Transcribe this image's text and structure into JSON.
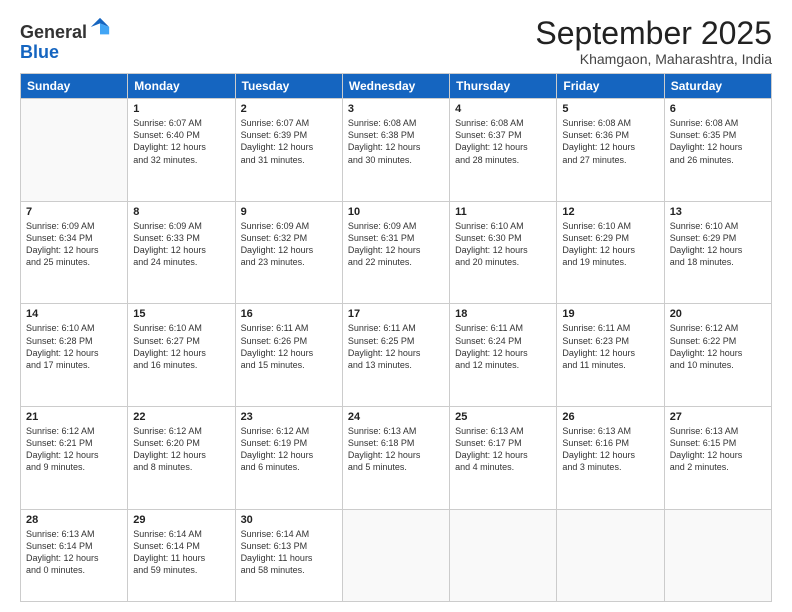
{
  "logo": {
    "general": "General",
    "blue": "Blue"
  },
  "title": "September 2025",
  "location": "Khamgaon, Maharashtra, India",
  "days_of_week": [
    "Sunday",
    "Monday",
    "Tuesday",
    "Wednesday",
    "Thursday",
    "Friday",
    "Saturday"
  ],
  "weeks": [
    [
      {
        "day": "",
        "info": ""
      },
      {
        "day": "1",
        "info": "Sunrise: 6:07 AM\nSunset: 6:40 PM\nDaylight: 12 hours\nand 32 minutes."
      },
      {
        "day": "2",
        "info": "Sunrise: 6:07 AM\nSunset: 6:39 PM\nDaylight: 12 hours\nand 31 minutes."
      },
      {
        "day": "3",
        "info": "Sunrise: 6:08 AM\nSunset: 6:38 PM\nDaylight: 12 hours\nand 30 minutes."
      },
      {
        "day": "4",
        "info": "Sunrise: 6:08 AM\nSunset: 6:37 PM\nDaylight: 12 hours\nand 28 minutes."
      },
      {
        "day": "5",
        "info": "Sunrise: 6:08 AM\nSunset: 6:36 PM\nDaylight: 12 hours\nand 27 minutes."
      },
      {
        "day": "6",
        "info": "Sunrise: 6:08 AM\nSunset: 6:35 PM\nDaylight: 12 hours\nand 26 minutes."
      }
    ],
    [
      {
        "day": "7",
        "info": "Sunrise: 6:09 AM\nSunset: 6:34 PM\nDaylight: 12 hours\nand 25 minutes."
      },
      {
        "day": "8",
        "info": "Sunrise: 6:09 AM\nSunset: 6:33 PM\nDaylight: 12 hours\nand 24 minutes."
      },
      {
        "day": "9",
        "info": "Sunrise: 6:09 AM\nSunset: 6:32 PM\nDaylight: 12 hours\nand 23 minutes."
      },
      {
        "day": "10",
        "info": "Sunrise: 6:09 AM\nSunset: 6:31 PM\nDaylight: 12 hours\nand 22 minutes."
      },
      {
        "day": "11",
        "info": "Sunrise: 6:10 AM\nSunset: 6:30 PM\nDaylight: 12 hours\nand 20 minutes."
      },
      {
        "day": "12",
        "info": "Sunrise: 6:10 AM\nSunset: 6:29 PM\nDaylight: 12 hours\nand 19 minutes."
      },
      {
        "day": "13",
        "info": "Sunrise: 6:10 AM\nSunset: 6:29 PM\nDaylight: 12 hours\nand 18 minutes."
      }
    ],
    [
      {
        "day": "14",
        "info": "Sunrise: 6:10 AM\nSunset: 6:28 PM\nDaylight: 12 hours\nand 17 minutes."
      },
      {
        "day": "15",
        "info": "Sunrise: 6:10 AM\nSunset: 6:27 PM\nDaylight: 12 hours\nand 16 minutes."
      },
      {
        "day": "16",
        "info": "Sunrise: 6:11 AM\nSunset: 6:26 PM\nDaylight: 12 hours\nand 15 minutes."
      },
      {
        "day": "17",
        "info": "Sunrise: 6:11 AM\nSunset: 6:25 PM\nDaylight: 12 hours\nand 13 minutes."
      },
      {
        "day": "18",
        "info": "Sunrise: 6:11 AM\nSunset: 6:24 PM\nDaylight: 12 hours\nand 12 minutes."
      },
      {
        "day": "19",
        "info": "Sunrise: 6:11 AM\nSunset: 6:23 PM\nDaylight: 12 hours\nand 11 minutes."
      },
      {
        "day": "20",
        "info": "Sunrise: 6:12 AM\nSunset: 6:22 PM\nDaylight: 12 hours\nand 10 minutes."
      }
    ],
    [
      {
        "day": "21",
        "info": "Sunrise: 6:12 AM\nSunset: 6:21 PM\nDaylight: 12 hours\nand 9 minutes."
      },
      {
        "day": "22",
        "info": "Sunrise: 6:12 AM\nSunset: 6:20 PM\nDaylight: 12 hours\nand 8 minutes."
      },
      {
        "day": "23",
        "info": "Sunrise: 6:12 AM\nSunset: 6:19 PM\nDaylight: 12 hours\nand 6 minutes."
      },
      {
        "day": "24",
        "info": "Sunrise: 6:13 AM\nSunset: 6:18 PM\nDaylight: 12 hours\nand 5 minutes."
      },
      {
        "day": "25",
        "info": "Sunrise: 6:13 AM\nSunset: 6:17 PM\nDaylight: 12 hours\nand 4 minutes."
      },
      {
        "day": "26",
        "info": "Sunrise: 6:13 AM\nSunset: 6:16 PM\nDaylight: 12 hours\nand 3 minutes."
      },
      {
        "day": "27",
        "info": "Sunrise: 6:13 AM\nSunset: 6:15 PM\nDaylight: 12 hours\nand 2 minutes."
      }
    ],
    [
      {
        "day": "28",
        "info": "Sunrise: 6:13 AM\nSunset: 6:14 PM\nDaylight: 12 hours\nand 0 minutes."
      },
      {
        "day": "29",
        "info": "Sunrise: 6:14 AM\nSunset: 6:14 PM\nDaylight: 11 hours\nand 59 minutes."
      },
      {
        "day": "30",
        "info": "Sunrise: 6:14 AM\nSunset: 6:13 PM\nDaylight: 11 hours\nand 58 minutes."
      },
      {
        "day": "",
        "info": ""
      },
      {
        "day": "",
        "info": ""
      },
      {
        "day": "",
        "info": ""
      },
      {
        "day": "",
        "info": ""
      }
    ]
  ]
}
